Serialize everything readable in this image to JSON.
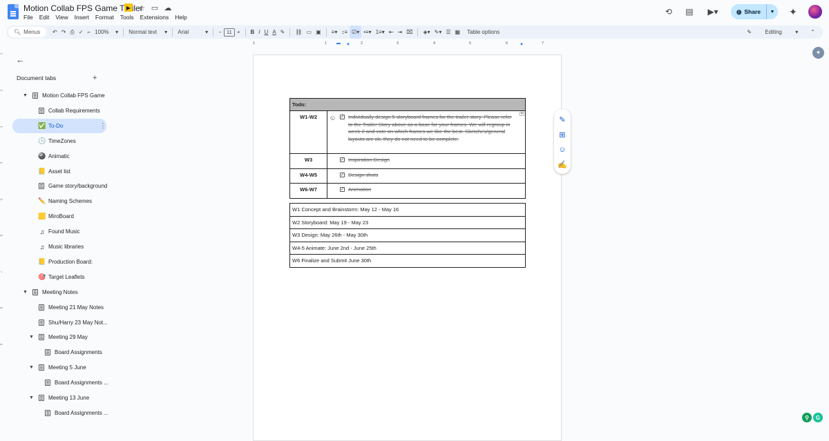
{
  "header": {
    "title": "Motion Collab FPS Game Trailer",
    "menu": [
      "File",
      "Edit",
      "View",
      "Insert",
      "Format",
      "Tools",
      "Extensions",
      "Help"
    ],
    "share_label": "Share",
    "icons": [
      "history-icon",
      "comment-icon",
      "meet-icon",
      "gemini-icon"
    ]
  },
  "toolbar": {
    "menus_placeholder": "Menus",
    "zoom": "100%",
    "style": "Normal text",
    "font": "Arial",
    "font_size": "11",
    "table_options": "Table options",
    "mode": "Editing"
  },
  "ruler": [
    "1",
    "1",
    "2",
    "3",
    "4",
    "5",
    "6",
    "7"
  ],
  "vruler": [
    "1",
    "2",
    "3",
    "4",
    "5",
    "6",
    "7",
    "8",
    "9"
  ],
  "sidebar": {
    "heading": "Document tabs",
    "tabs": [
      {
        "label": "Motion Collab FPS Game",
        "icon": "doc",
        "level": 0,
        "caret": true
      },
      {
        "label": "Collab Requirements",
        "icon": "doc",
        "level": 1
      },
      {
        "label": "To-Do",
        "icon": "✅",
        "level": 1,
        "selected": true
      },
      {
        "label": "TimeZones",
        "icon": "🕓",
        "level": 1
      },
      {
        "label": "Animatic",
        "icon": "🎱",
        "level": 1
      },
      {
        "label": "Asset list",
        "icon": "📒",
        "level": 1
      },
      {
        "label": "Game story/background",
        "icon": "doc",
        "level": 1
      },
      {
        "label": "Naming Schemes",
        "icon": "✏️",
        "level": 1
      },
      {
        "label": "MiroBoard",
        "icon": "🟨",
        "level": 1
      },
      {
        "label": "Found Music",
        "icon": "♫",
        "level": 1
      },
      {
        "label": "Music libraries",
        "icon": "♫",
        "level": 1
      },
      {
        "label": "Production Board:",
        "icon": "📒",
        "level": 1
      },
      {
        "label": "Target Leaflets",
        "icon": "🎯",
        "level": 1
      },
      {
        "label": "Meeting Notes",
        "icon": "doc",
        "level": 0,
        "caret": true
      },
      {
        "label": "Meeting 21 May Notes",
        "icon": "doc",
        "level": 1
      },
      {
        "label": "Shu/Harry 23 May Not...",
        "icon": "doc",
        "level": 1
      },
      {
        "label": "Meeting 29 May",
        "icon": "doc",
        "level": 1,
        "caret": true
      },
      {
        "label": "Board Assignments",
        "icon": "doc",
        "level": 2
      },
      {
        "label": "Meeting 5 June",
        "icon": "doc",
        "level": 1,
        "caret": true
      },
      {
        "label": "Board Assignments ...",
        "icon": "doc",
        "level": 2
      },
      {
        "label": "Meeting 13 June",
        "icon": "doc",
        "level": 1,
        "caret": true
      },
      {
        "label": "Board Assignments ...",
        "icon": "doc",
        "level": 2
      }
    ]
  },
  "todo": {
    "header": "Todo:",
    "rows": [
      {
        "week": "W1-W2",
        "text": "Individually design 5 storyboard frames for the trailer story. Please refer to the Trailer Story above as a base for your frames. We will regroup in week 2 and vote on which frames we like the best. Sketches/general layouts are ok, they do not need to be complete."
      },
      {
        "week": "W3",
        "text": "Inspiration Design"
      },
      {
        "week": "W4-W5",
        "text": "Design shots"
      },
      {
        "week": "W6-W7",
        "text": "Animation"
      }
    ]
  },
  "schedule": [
    "W1 Concept and Brainstorm: May 12 - May 16",
    "W2 Storyboard: May 19 - May 23",
    "W3 Design: May 26th - May 30th",
    "W4-5 Animate: June 2nd - June 25th",
    "W6 Finalize and Submit June 30th"
  ]
}
